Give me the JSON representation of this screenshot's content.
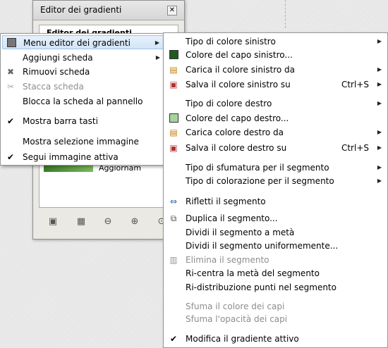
{
  "dialog": {
    "title": "Editor dei gradienti",
    "close_icon": "close-icon",
    "tab_label": "Editor dei gradienti",
    "row_text": "Aggiornamento istantaneo"
  },
  "left_menu": {
    "items": [
      {
        "label": "Menu editor dei gradienti",
        "icon": "tab-menu-icon",
        "submenu": true,
        "highlighted": true
      },
      {
        "label": "Aggiungi scheda",
        "submenu": true
      },
      {
        "label": "Rimuovi scheda",
        "icon": "close-x-icon"
      },
      {
        "label": "Stacca scheda",
        "icon": "detach-icon",
        "disabled": true
      },
      {
        "label": "Blocca la scheda al pannello"
      },
      {
        "label": "Mostra barra tasti",
        "checked": true
      },
      {
        "label": "Mostra selezione immagine"
      },
      {
        "label": "Segui immagine attiva",
        "checked": true
      }
    ]
  },
  "right_menu": {
    "items": [
      {
        "label": "Tipo di colore sinistro",
        "submenu": true
      },
      {
        "label": "Colore del capo sinistro...",
        "swatch": "#1f5a1f"
      },
      {
        "label": "Carica il colore sinistro da",
        "icon": "load-color-icon",
        "submenu": true
      },
      {
        "label": "Salva il colore sinistro su",
        "icon": "save-color-icon",
        "accel": "Ctrl+S",
        "submenu": true
      },
      {
        "label": "Tipo di colore destro",
        "submenu": true
      },
      {
        "label": "Colore del capo destro...",
        "swatch": "#a6d49a"
      },
      {
        "label": "Carica colore destro da",
        "icon": "load-color-icon",
        "submenu": true
      },
      {
        "label": "Salva il colore destro su",
        "icon": "save-color-icon",
        "accel": "Ctrl+S",
        "submenu": true
      },
      {
        "label": "Tipo di sfumatura per il segmento",
        "submenu": true
      },
      {
        "label": "Tipo di colorazione per il segmento",
        "submenu": true
      },
      {
        "label": "Rifletti il segmento",
        "icon": "flip-icon"
      },
      {
        "label": "Duplica il segmento...",
        "icon": "duplicate-icon"
      },
      {
        "label": "Dividi il segmento a metà"
      },
      {
        "label": "Dividi il segmento uniformemente..."
      },
      {
        "label": "Elimina il segmento",
        "icon": "delete-icon",
        "disabled": true
      },
      {
        "label": "Ri-centra la metà del segmento"
      },
      {
        "label": "Ri-distribuzione punti nel segmento"
      },
      {
        "label": "Sfuma il colore dei capi",
        "disabled": true
      },
      {
        "label": "Sfuma l'opacità dei capi",
        "disabled": true
      },
      {
        "label": "Modifica il gradiente attivo",
        "checked": true
      }
    ]
  }
}
